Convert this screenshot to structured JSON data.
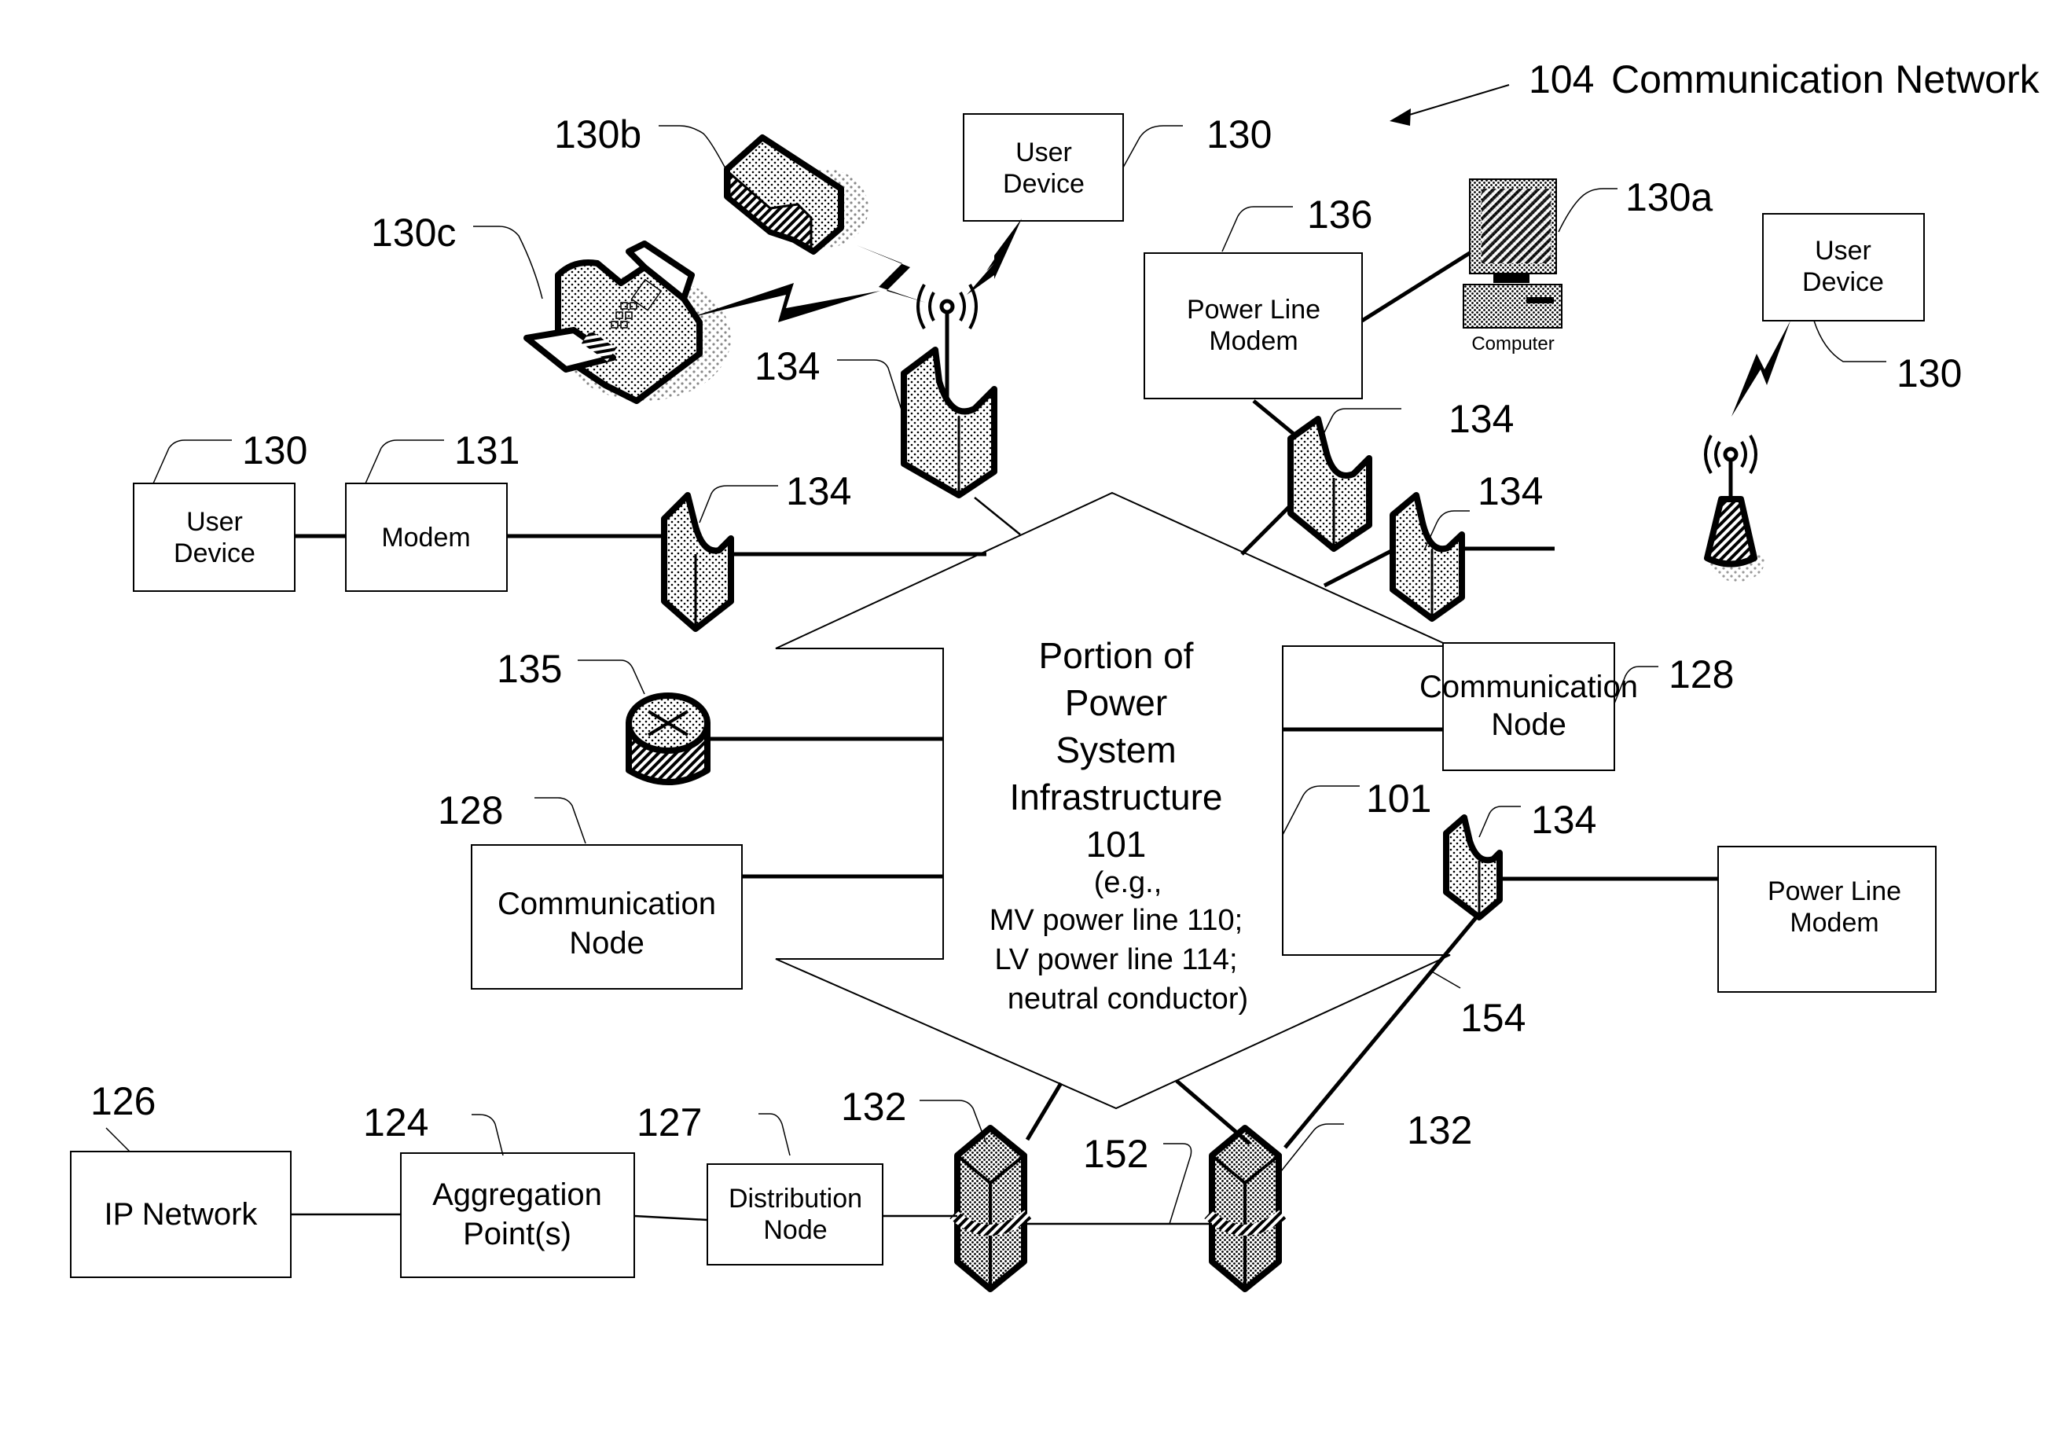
{
  "figure": {
    "title": "104 Communication Network",
    "title_ref": "104",
    "title_text": "Communication Network"
  },
  "center": {
    "lines": [
      "Portion of",
      "Power",
      "System",
      "Infrastructure",
      "101"
    ],
    "sub_lines": [
      "(e.g.,",
      "MV power line 110;",
      "LV power line 114;",
      "neutral conductor)"
    ],
    "ref_101": "101"
  },
  "boxes": {
    "user_device_top": {
      "lines": [
        "User",
        "Device"
      ],
      "ref": "130"
    },
    "user_device_right": {
      "lines": [
        "User",
        "Device"
      ],
      "ref": "130"
    },
    "user_device_left": {
      "lines": [
        "User",
        "Device"
      ],
      "ref": "130"
    },
    "modem": {
      "lines": [
        "Modem"
      ],
      "ref": "131"
    },
    "plm_top": {
      "lines": [
        "Power Line",
        "Modem"
      ],
      "ref": "136"
    },
    "plm_right": {
      "lines": [
        "Power Line",
        "Modem"
      ]
    },
    "comm_node_left": {
      "lines": [
        "Communication",
        "Node"
      ],
      "ref": "128"
    },
    "comm_node_right": {
      "lines": [
        "Communication",
        "Node"
      ],
      "ref": "128"
    },
    "ip_network": {
      "lines": [
        "IP Network"
      ],
      "ref": "126"
    },
    "aggregation": {
      "lines": [
        "Aggregation",
        "Point(s)"
      ],
      "ref": "124"
    },
    "distribution": {
      "lines": [
        "Distribution",
        "Node"
      ],
      "ref": "127"
    }
  },
  "devices": {
    "computer": {
      "caption": "Computer",
      "ref": "130a"
    },
    "router_device": {
      "ref": "130b"
    },
    "fax": {
      "ref": "130c"
    },
    "router_135": {
      "ref": "135"
    },
    "couplers": {
      "ref": "134"
    },
    "backhaul_left": {
      "ref": "132"
    },
    "backhaul_right": {
      "ref": "132"
    }
  },
  "links": {
    "ref_152": "152",
    "ref_154": "154"
  }
}
